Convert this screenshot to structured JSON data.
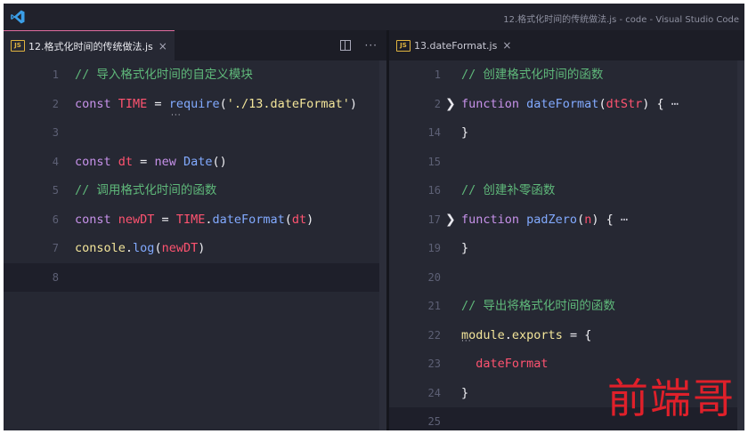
{
  "window": {
    "title": "12.格式化时间的传统做法.js - code - Visual Studio Code",
    "logo_icon": "vscode-logo-icon",
    "accent_color": "#e06c9f"
  },
  "left_pane": {
    "tab": {
      "icon": "JS",
      "label": "12.格式化时间的传统做法.js",
      "close": "×"
    },
    "actions": {
      "split_icon": "split-editor-icon",
      "more": "···"
    },
    "lines": [
      {
        "num": "1",
        "tokens": [
          {
            "t": "// 导入格式化时间的自定义模块",
            "c": "c-comment"
          }
        ]
      },
      {
        "num": "2",
        "tokens": [
          {
            "t": "const ",
            "c": "c-kw"
          },
          {
            "t": "TIME",
            "c": "c-var"
          },
          {
            "t": " = ",
            "c": "c-plain"
          },
          {
            "t": "require",
            "c": "c-fn"
          },
          {
            "t": "(",
            "c": "c-plain"
          },
          {
            "t": "'./13.dateFormat'",
            "c": "c-str"
          },
          {
            "t": ")",
            "c": "c-plain"
          }
        ]
      },
      {
        "num": "3",
        "tokens": []
      },
      {
        "num": "4",
        "tokens": [
          {
            "t": "const ",
            "c": "c-kw"
          },
          {
            "t": "dt",
            "c": "c-var"
          },
          {
            "t": " = ",
            "c": "c-plain"
          },
          {
            "t": "new ",
            "c": "c-kw"
          },
          {
            "t": "Date",
            "c": "c-fn"
          },
          {
            "t": "()",
            "c": "c-plain"
          }
        ]
      },
      {
        "num": "5",
        "tokens": [
          {
            "t": "// 调用格式化时间的函数",
            "c": "c-comment"
          }
        ]
      },
      {
        "num": "6",
        "tokens": [
          {
            "t": "const ",
            "c": "c-kw"
          },
          {
            "t": "newDT",
            "c": "c-var"
          },
          {
            "t": " = ",
            "c": "c-plain"
          },
          {
            "t": "TIME",
            "c": "c-var"
          },
          {
            "t": ".",
            "c": "c-plain"
          },
          {
            "t": "dateFormat",
            "c": "c-fn"
          },
          {
            "t": "(",
            "c": "c-plain"
          },
          {
            "t": "dt",
            "c": "c-var"
          },
          {
            "t": ")",
            "c": "c-plain"
          }
        ]
      },
      {
        "num": "7",
        "tokens": [
          {
            "t": "console",
            "c": "c-str"
          },
          {
            "t": ".",
            "c": "c-plain"
          },
          {
            "t": "log",
            "c": "c-fn"
          },
          {
            "t": "(",
            "c": "c-plain"
          },
          {
            "t": "newDT",
            "c": "c-var"
          },
          {
            "t": ")",
            "c": "c-plain"
          }
        ]
      },
      {
        "num": "8",
        "tokens": []
      }
    ],
    "inline_dots": "···"
  },
  "right_pane": {
    "tab": {
      "icon": "JS",
      "label": "13.dateFormat.js",
      "close": "×"
    },
    "lines": [
      {
        "num": "1",
        "tokens": [
          {
            "t": "// 创建格式化时间的函数",
            "c": "c-comment"
          }
        ]
      },
      {
        "num": "2",
        "fold": "❯",
        "tokens": [
          {
            "t": "function ",
            "c": "c-kw"
          },
          {
            "t": "dateFormat",
            "c": "c-fn"
          },
          {
            "t": "(",
            "c": "c-plain"
          },
          {
            "t": "dtStr",
            "c": "c-var"
          },
          {
            "t": ") { ",
            "c": "c-plain"
          },
          {
            "t": "⋯",
            "c": "c-ellipsis"
          }
        ]
      },
      {
        "num": "14",
        "tokens": [
          {
            "t": "}",
            "c": "c-plain"
          }
        ]
      },
      {
        "num": "15",
        "tokens": []
      },
      {
        "num": "16",
        "tokens": [
          {
            "t": "// 创建补零函数",
            "c": "c-comment"
          }
        ]
      },
      {
        "num": "17",
        "fold": "❯",
        "tokens": [
          {
            "t": "function ",
            "c": "c-kw"
          },
          {
            "t": "padZero",
            "c": "c-fn"
          },
          {
            "t": "(",
            "c": "c-plain"
          },
          {
            "t": "n",
            "c": "c-var"
          },
          {
            "t": ") { ",
            "c": "c-plain"
          },
          {
            "t": "⋯",
            "c": "c-ellipsis"
          }
        ]
      },
      {
        "num": "19",
        "tokens": [
          {
            "t": "}",
            "c": "c-plain"
          }
        ]
      },
      {
        "num": "20",
        "tokens": []
      },
      {
        "num": "21",
        "tokens": [
          {
            "t": "// 导出将格式化时间的函数",
            "c": "c-comment"
          }
        ]
      },
      {
        "num": "22",
        "tokens": [
          {
            "t": "module",
            "c": "c-str"
          },
          {
            "t": ".",
            "c": "c-plain"
          },
          {
            "t": "exports",
            "c": "c-str"
          },
          {
            "t": " = {",
            "c": "c-plain"
          }
        ]
      },
      {
        "num": "23",
        "tokens": [
          {
            "t": "  dateFormat",
            "c": "c-var"
          }
        ]
      },
      {
        "num": "24",
        "tokens": [
          {
            "t": "}",
            "c": "c-plain"
          }
        ]
      },
      {
        "num": "25",
        "tokens": []
      }
    ],
    "inline_dots": "···"
  },
  "watermark": "前端哥"
}
